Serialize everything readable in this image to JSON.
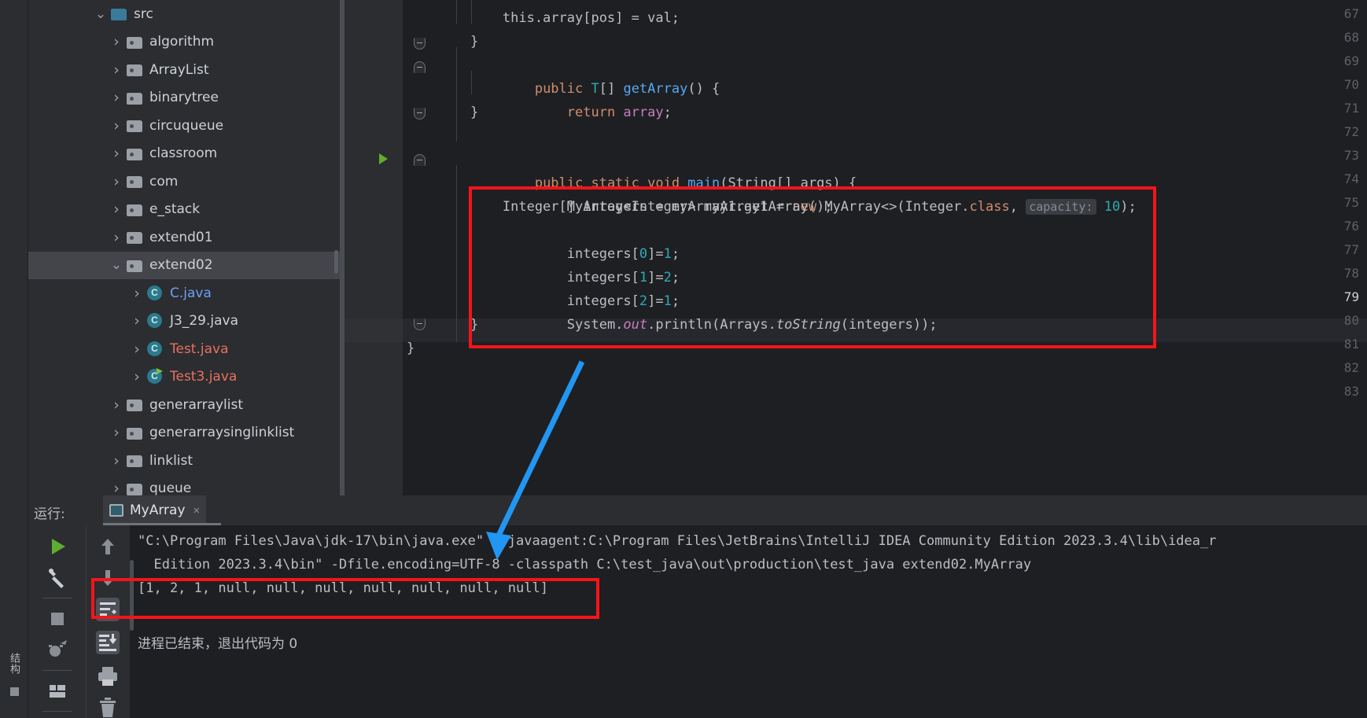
{
  "theme": {
    "editor_bg": "#1e1f22",
    "panel_bg": "#2b2d30",
    "selection_bg": "#43454a",
    "annotation_red": "#f4141a",
    "annotation_blue": "#2196f3",
    "keyword_orange": "#cf8e6d",
    "method_blue": "#56a8f5",
    "field_purple": "#c77dbb",
    "number_teal": "#2aacb8",
    "text_gray": "#bcbec4"
  },
  "left_strip": {
    "structure_label": "结构"
  },
  "project_tree": {
    "items": [
      {
        "label": "src",
        "indent": 0,
        "icon": "folder-blue",
        "chev": "down",
        "selected": false,
        "color": "default"
      },
      {
        "label": "algorithm",
        "indent": 1,
        "icon": "folder-gray",
        "chev": "right",
        "selected": false,
        "color": "default"
      },
      {
        "label": "ArrayList",
        "indent": 1,
        "icon": "folder-gray",
        "chev": "right",
        "selected": false,
        "color": "default"
      },
      {
        "label": "binarytree",
        "indent": 1,
        "icon": "folder-gray",
        "chev": "right",
        "selected": false,
        "color": "default"
      },
      {
        "label": "circuqueue",
        "indent": 1,
        "icon": "folder-gray",
        "chev": "right",
        "selected": false,
        "color": "default"
      },
      {
        "label": "classroom",
        "indent": 1,
        "icon": "folder-gray",
        "chev": "right",
        "selected": false,
        "color": "default"
      },
      {
        "label": "com",
        "indent": 1,
        "icon": "folder-gray",
        "chev": "right",
        "selected": false,
        "color": "default"
      },
      {
        "label": "e_stack",
        "indent": 1,
        "icon": "folder-gray",
        "chev": "right",
        "selected": false,
        "color": "default"
      },
      {
        "label": "extend01",
        "indent": 1,
        "icon": "folder-gray",
        "chev": "right",
        "selected": false,
        "color": "default"
      },
      {
        "label": "extend02",
        "indent": 1,
        "icon": "folder-gray",
        "chev": "down",
        "selected": true,
        "color": "default"
      },
      {
        "label": "C.java",
        "indent": 2,
        "icon": "java-class",
        "chev": "right",
        "selected": false,
        "color": "blue"
      },
      {
        "label": "J3_29.java",
        "indent": 2,
        "icon": "java-class",
        "chev": "right",
        "selected": false,
        "color": "default"
      },
      {
        "label": "Test.java",
        "indent": 2,
        "icon": "java-class",
        "chev": "right",
        "selected": false,
        "color": "red"
      },
      {
        "label": "Test3.java",
        "indent": 2,
        "icon": "java-class-run",
        "chev": "right",
        "selected": false,
        "color": "red"
      },
      {
        "label": "generarraylist",
        "indent": 1,
        "icon": "folder-gray",
        "chev": "right",
        "selected": false,
        "color": "default"
      },
      {
        "label": "generarraysinglinklist",
        "indent": 1,
        "icon": "folder-gray",
        "chev": "right",
        "selected": false,
        "color": "default"
      },
      {
        "label": "linklist",
        "indent": 1,
        "icon": "folder-gray",
        "chev": "right",
        "selected": false,
        "color": "default"
      },
      {
        "label": "queue",
        "indent": 1,
        "icon": "folder-gray",
        "chev": "right",
        "selected": false,
        "color": "default"
      }
    ]
  },
  "editor": {
    "active_line": 79,
    "line_numbers": [
      67,
      68,
      69,
      70,
      71,
      72,
      73,
      74,
      75,
      76,
      77,
      78,
      79,
      80,
      81,
      82,
      83
    ],
    "code_lines": {
      "l67": "        this.array[pos] = val;",
      "l68": "    }",
      "l69_a": "    public ",
      "l69_b": "T",
      "l69_c": "[] ",
      "l69_d": "getArray",
      "l69_e": "() {",
      "l70_a": "        return ",
      "l70_b": "array",
      "l70_c": ";",
      "l71": "    }",
      "l73_a": "    public static void ",
      "l73_b": "main",
      "l73_c": "(String[] args) {",
      "l74_a": "        MyArray<Integer> myArray1 = ",
      "l74_b": "new",
      "l74_c": " MyArray<>(Integer.",
      "l74_d": "class",
      "l74_e": ", ",
      "l74_hint": "capacity:",
      "l74_f": "10",
      "l74_g": ");",
      "l75": "        Integer[] integers = myArray1.getArray();",
      "l76_a": "        integers[",
      "l76_b": "0",
      "l76_c": "]=",
      "l76_d": "1",
      "l76_e": ";",
      "l77_a": "        integers[",
      "l77_b": "1",
      "l77_c": "]=",
      "l77_d": "2",
      "l77_e": ";",
      "l78_a": "        integers[",
      "l78_b": "2",
      "l78_c": "]=",
      "l78_d": "1",
      "l78_e": ";",
      "l79_a": "        System.",
      "l79_b": "out",
      "l79_c": ".println(Arrays.",
      "l79_d": "toString",
      "l79_e": "(integers));",
      "l80": "    }",
      "l81": "}"
    }
  },
  "run_panel": {
    "run_label": "运行:",
    "tab_name": "MyArray",
    "tab_close": "×",
    "console_lines": [
      "\"C:\\Program Files\\Java\\jdk-17\\bin\\java.exe\" \"-javaagent:C:\\Program Files\\JetBrains\\IntelliJ IDEA Community Edition 2023.3.4\\lib\\idea_r",
      "  Edition 2023.3.4\\bin\" -Dfile.encoding=UTF-8 -classpath C:\\test_java\\out\\production\\test_java extend02.MyArray",
      "[1, 2, 1, null, null, null, null, null, null, null]",
      "进程已结束，退出代码为 0"
    ],
    "toolbar_left": [
      {
        "name": "rerun-button",
        "glyph": "play"
      },
      {
        "name": "settings-button",
        "glyph": "wrench"
      },
      {
        "name": "stop-button",
        "glyph": "stop"
      },
      {
        "name": "rerun-failed-button",
        "glyph": "bug-rerun"
      },
      {
        "name": "layout-button",
        "glyph": "layout"
      }
    ],
    "toolbar_right": [
      {
        "name": "scroll-up-button",
        "glyph": "arrow-up"
      },
      {
        "name": "scroll-down-button",
        "glyph": "arrow-down"
      },
      {
        "name": "soft-wrap-button",
        "glyph": "soft-wrap"
      },
      {
        "name": "scroll-to-end-button",
        "glyph": "scroll-end"
      },
      {
        "name": "print-button",
        "glyph": "printer"
      },
      {
        "name": "clear-all-button",
        "glyph": "trash"
      }
    ]
  },
  "annotations": {
    "code_box_label": "code-highlight-box",
    "output_box_label": "output-highlight-box",
    "arrow_label": "blue-pointer-arrow"
  }
}
